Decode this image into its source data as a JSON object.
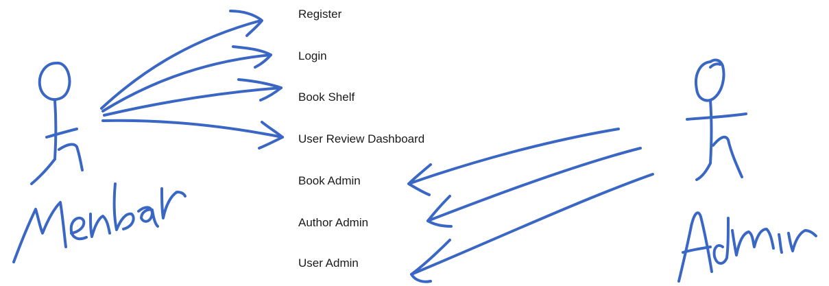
{
  "ink_color": "#3a67c4",
  "features": [
    {
      "label": "Register",
      "actor": "member"
    },
    {
      "label": "Login",
      "actor": "member"
    },
    {
      "label": "Book Shelf",
      "actor": "member"
    },
    {
      "label": "User Review Dashboard",
      "actor": "member"
    },
    {
      "label": "Book Admin",
      "actor": "admin"
    },
    {
      "label": "Author Admin",
      "actor": "admin"
    },
    {
      "label": "User Admin",
      "actor": "admin"
    }
  ],
  "actors": {
    "member": {
      "handwritten_label": "Member"
    },
    "admin": {
      "handwritten_label": "Admin"
    }
  }
}
